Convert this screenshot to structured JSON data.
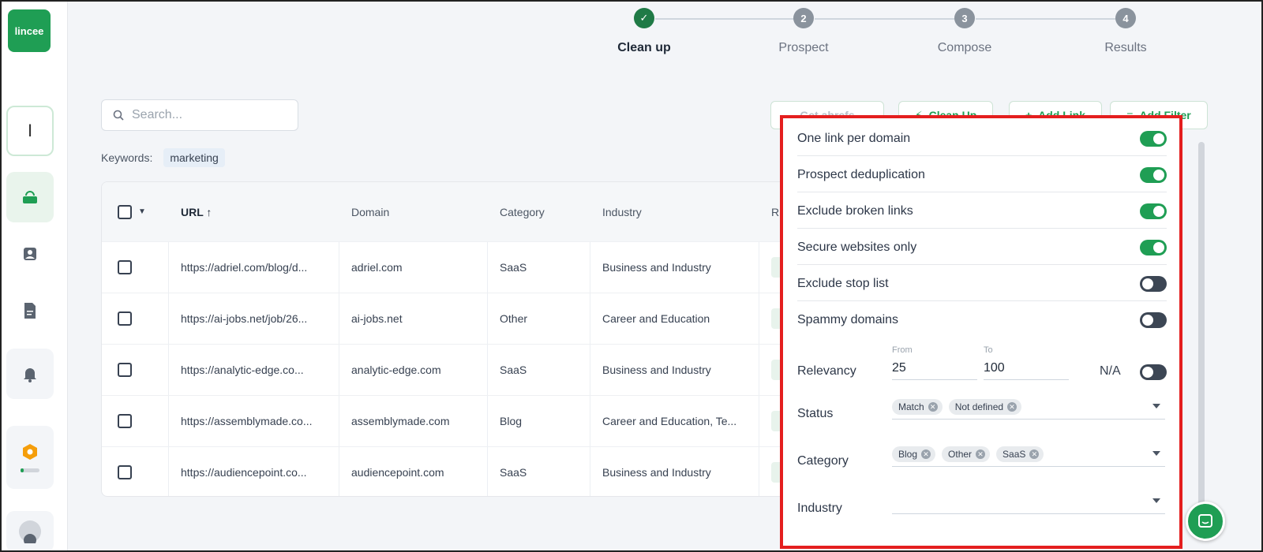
{
  "brand": {
    "logo_text": "lincee",
    "accent": "#1f9e54"
  },
  "sidebar": {
    "user_initial": "I",
    "items": [
      {
        "icon": "bag-icon"
      },
      {
        "icon": "contact-icon"
      },
      {
        "icon": "document-icon"
      },
      {
        "icon": "bell-icon"
      },
      {
        "icon": "hexagon-icon"
      },
      {
        "icon": "avatar-icon"
      }
    ]
  },
  "stepper": {
    "steps": [
      {
        "number": "✓",
        "label": "Clean up",
        "state": "done"
      },
      {
        "number": "2",
        "label": "Prospect",
        "state": "pending"
      },
      {
        "number": "3",
        "label": "Compose",
        "state": "pending"
      },
      {
        "number": "4",
        "label": "Results",
        "state": "pending"
      }
    ]
  },
  "search": {
    "placeholder": "Search..."
  },
  "keywords": {
    "label": "Keywords:",
    "items": [
      "marketing"
    ]
  },
  "toolbar": {
    "get_ahrefs": "Get ahrefs",
    "clean_up": "Clean Up",
    "add_link": "Add Link",
    "add_filter": "Add Filter"
  },
  "table": {
    "headers": {
      "url": "URL ↑",
      "domain": "Domain",
      "category": "Category",
      "industry": "Industry",
      "extra": "R"
    },
    "rows": [
      {
        "url": "https://adriel.com/blog/d...",
        "domain": "adriel.com",
        "category": "SaaS",
        "industry": "Business and Industry"
      },
      {
        "url": "https://ai-jobs.net/job/26...",
        "domain": "ai-jobs.net",
        "category": "Other",
        "industry": "Career and Education"
      },
      {
        "url": "https://analytic-edge.co...",
        "domain": "analytic-edge.com",
        "category": "SaaS",
        "industry": "Business and Industry"
      },
      {
        "url": "https://assemblymade.co...",
        "domain": "assemblymade.com",
        "category": "Blog",
        "industry": "Career and Education, Te..."
      },
      {
        "url": "https://audiencepoint.co...",
        "domain": "audiencepoint.com",
        "category": "SaaS",
        "industry": "Business and Industry"
      }
    ]
  },
  "filters": {
    "toggles": [
      {
        "label": "One link per domain",
        "on": true
      },
      {
        "label": "Prospect deduplication",
        "on": true
      },
      {
        "label": "Exclude broken links",
        "on": true
      },
      {
        "label": "Secure websites only",
        "on": true
      },
      {
        "label": "Exclude stop list",
        "on": false
      },
      {
        "label": "Spammy domains",
        "on": false
      }
    ],
    "relevancy": {
      "label": "Relevancy",
      "from_label": "From",
      "from": "25",
      "to_label": "To",
      "to": "100",
      "na_label": "N/A",
      "na_on": false
    },
    "status": {
      "label": "Status",
      "tags": [
        "Match",
        "Not defined"
      ]
    },
    "category": {
      "label": "Category",
      "tags": [
        "Blog",
        "Other",
        "SaaS"
      ]
    },
    "industry": {
      "label": "Industry",
      "tags": []
    }
  }
}
